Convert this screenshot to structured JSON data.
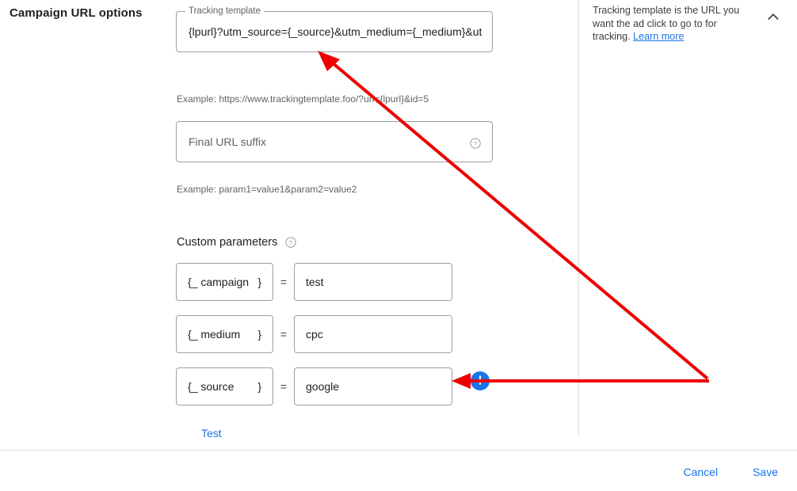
{
  "page_title": "Campaign URL options",
  "tracking_template": {
    "legend": "Tracking template",
    "value": "{lpurl}?utm_source={_source}&utm_medium={_medium}&ut",
    "example": "Example: https://www.trackingtemplate.foo/?url={lpurl}&id=5"
  },
  "final_url_suffix": {
    "placeholder": "Final URL suffix",
    "help_icon": "help-circle-icon",
    "example": "Example: param1=value1&param2=value2"
  },
  "custom_parameters": {
    "label": "Custom parameters",
    "help_icon": "help-circle-icon",
    "equals_symbol": "=",
    "rows": [
      {
        "open_brace": "{",
        "key": "_ campaign",
        "close_brace": "}",
        "value": "test"
      },
      {
        "open_brace": "{",
        "key": "_ medium",
        "close_brace": "}",
        "value": "cpc"
      },
      {
        "open_brace": "{",
        "key": "_ source",
        "close_brace": "}",
        "value": "google"
      }
    ],
    "add_button_icon": "plus-icon",
    "test_link": "Test"
  },
  "help_panel": {
    "text": "Tracking template is the URL you want the ad click to go to for tracking. ",
    "learn_more": "Learn more",
    "collapse_icon": "chevron-up-icon"
  },
  "footer": {
    "cancel_label": "Cancel",
    "save_label": "Save"
  },
  "colors": {
    "accent": "#1a73e8",
    "annotation": "#ee0000",
    "border": "#9aa0a6",
    "divider": "#dadce0",
    "text_primary": "#202124",
    "text_secondary": "#5f6368"
  }
}
